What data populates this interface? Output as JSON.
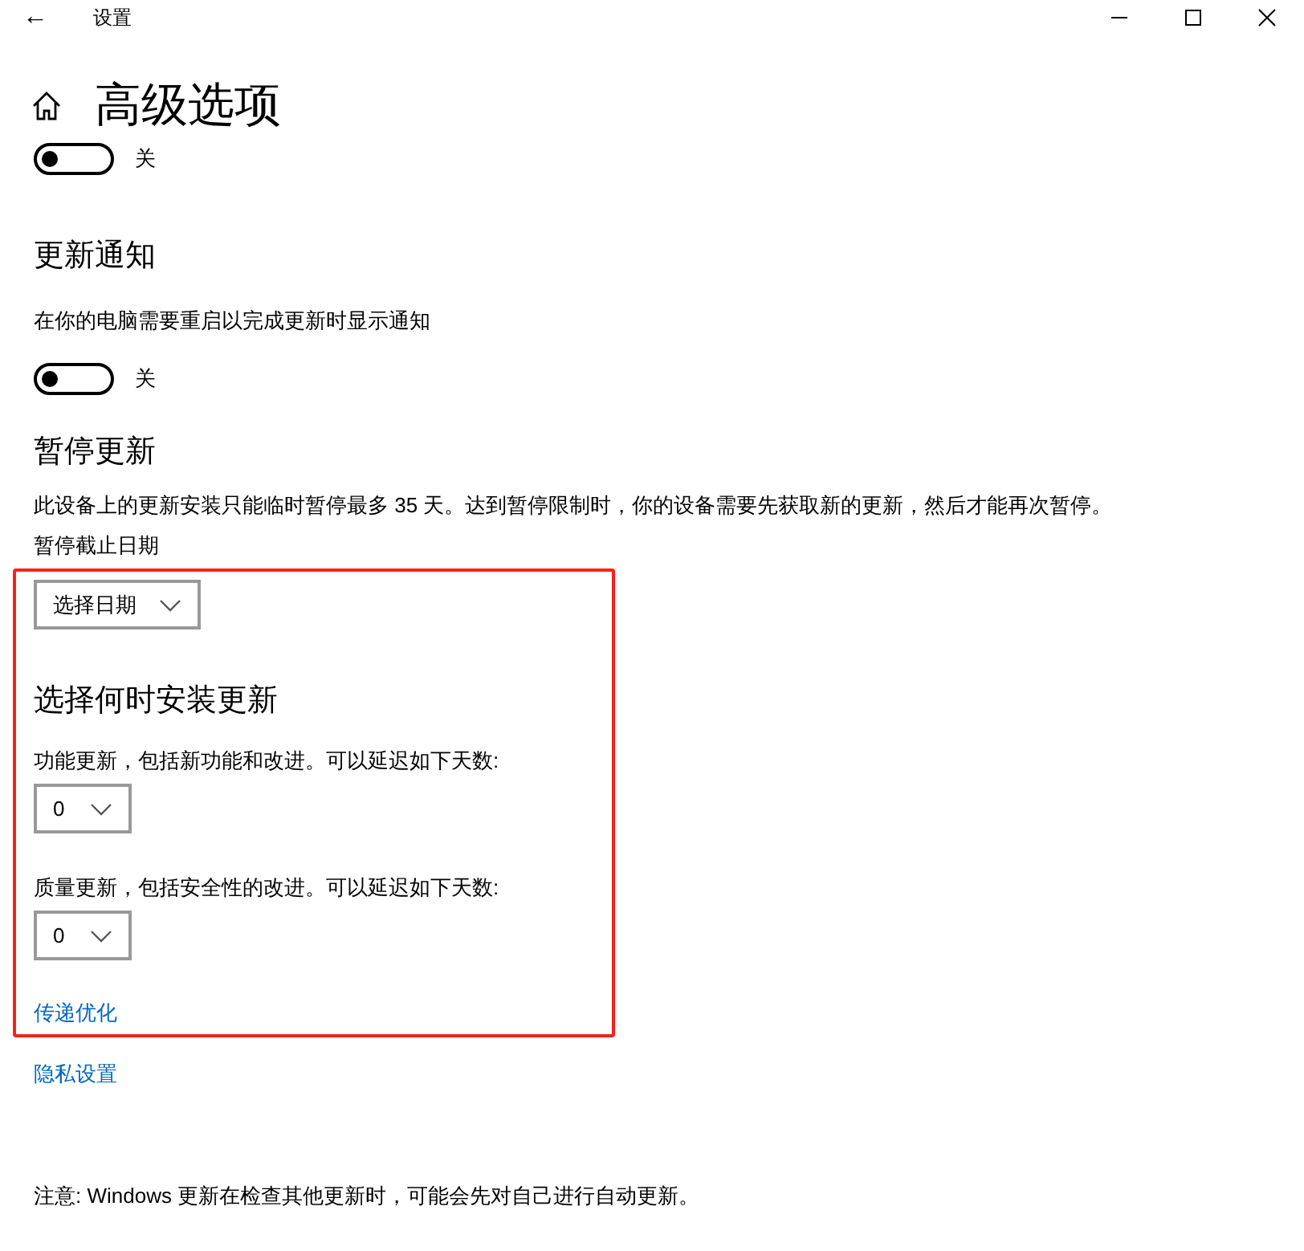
{
  "window": {
    "title": "设置",
    "back": "←"
  },
  "page": {
    "title": "高级选项"
  },
  "top_toggle": {
    "on": false,
    "label": "关"
  },
  "sections": [
    {
      "heading": "更新通知",
      "items": [
        {
          "kind": "text",
          "text": "在你的电脑需要重启以完成更新时显示通知"
        },
        {
          "kind": "toggle",
          "on": false,
          "label": "关"
        }
      ]
    },
    {
      "heading": "暂停更新",
      "items": [
        {
          "kind": "text",
          "text": "此设备上的更新安装只能临时暂停最多 35 天。达到暂停限制时，你的设备需要先获取新的更新，然后才能再次暂停。"
        },
        {
          "kind": "text",
          "text": "暂停截止日期"
        },
        {
          "kind": "dropdown",
          "value": "选择日期"
        }
      ]
    },
    {
      "heading": "选择何时安装更新",
      "items": [
        {
          "kind": "text",
          "text": "功能更新，包括新功能和改进。可以延迟如下天数:"
        },
        {
          "kind": "dropdown",
          "value": "0"
        },
        {
          "kind": "text",
          "text": "质量更新，包括安全性的改进。可以延迟如下天数:"
        },
        {
          "kind": "dropdown",
          "value": "0"
        }
      ]
    }
  ],
  "links": [
    "传递优化",
    "隐私设置"
  ],
  "note": "注意: Windows 更新在检查其他更新时，可能会先对自己进行自动更新。"
}
